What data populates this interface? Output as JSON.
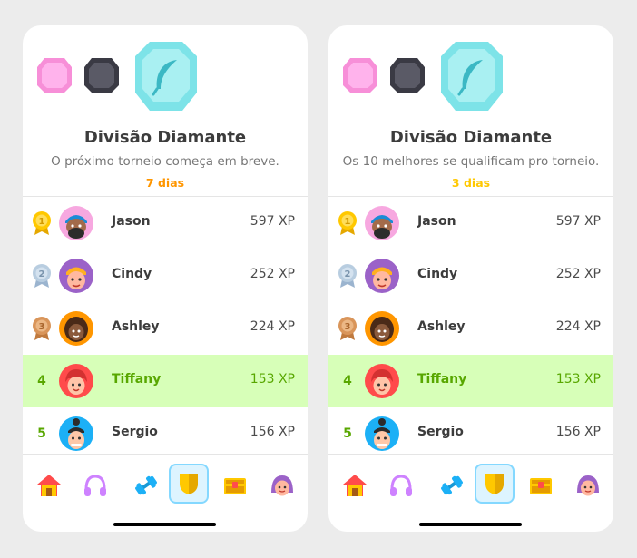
{
  "colors": {
    "left_days": "#ff9600",
    "right_days": "#ffc800",
    "highlight_green": "#58a700",
    "highlight_bg": "#d7ffb8"
  },
  "left": {
    "title": "Divisão Diamante",
    "subtitle": "O próximo torneio começa em breve.",
    "days": "7 dias"
  },
  "right": {
    "title": "Divisão Diamante",
    "subtitle": "Os 10 melhores se qualificam pro torneio.",
    "days": "3 dias"
  },
  "leaderboard": [
    {
      "rank": "1",
      "name": "Jason",
      "xp": "597 XP",
      "medal": "gold-medal-icon",
      "avatar": "jason-avatar"
    },
    {
      "rank": "2",
      "name": "Cindy",
      "xp": "252 XP",
      "medal": "silver-medal-icon",
      "avatar": "cindy-avatar"
    },
    {
      "rank": "3",
      "name": "Ashley",
      "xp": "224 XP",
      "medal": "bronze-medal-icon",
      "avatar": "ashley-avatar"
    },
    {
      "rank": "4",
      "name": "Tiffany",
      "xp": "153 XP",
      "highlight": true,
      "avatar": "tiffany-avatar"
    },
    {
      "rank": "5",
      "name": "Sergio",
      "xp": "156 XP",
      "avatar": "sergio-avatar"
    }
  ],
  "nav": [
    "home-icon",
    "headphones-icon",
    "dumbbell-icon",
    "shield-icon",
    "treasure-chest-icon",
    "profile-avatar-icon"
  ],
  "active_nav": "shield-icon"
}
